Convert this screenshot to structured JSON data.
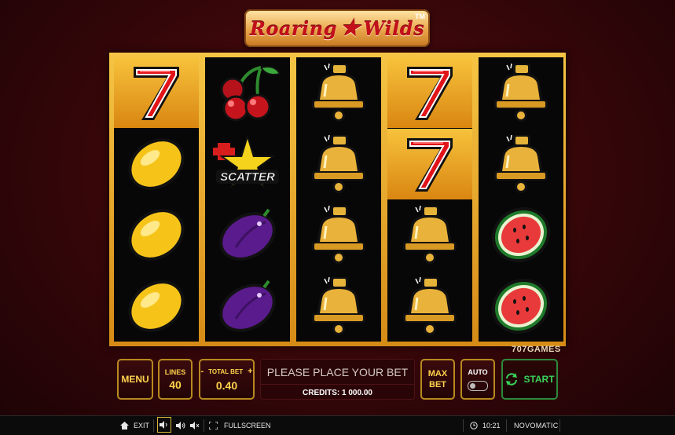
{
  "logo": {
    "text_left": "Roaring",
    "text_right": "Wilds",
    "tm": "TM"
  },
  "reels": [
    [
      "seven",
      "lemon",
      "lemon",
      "lemon"
    ],
    [
      "cherries",
      "scatter",
      "plum",
      "plum"
    ],
    [
      "bell",
      "bell",
      "bell",
      "bell"
    ],
    [
      "seven",
      "seven",
      "bell",
      "bell"
    ],
    [
      "bell",
      "bell",
      "watermelon",
      "watermelon"
    ]
  ],
  "winning_cells": [
    [
      0,
      0
    ],
    [
      3,
      0
    ],
    [
      3,
      1
    ]
  ],
  "scatter_label": "SCATTER",
  "studio": "707GAMES",
  "controls": {
    "menu_label": "MENU",
    "lines_label": "LINES",
    "lines_value": "40",
    "total_bet_label": "TOTAL BET",
    "total_bet_minus": "-",
    "total_bet_plus": "+",
    "total_bet_value": "0.40",
    "message": "PLEASE PLACE YOUR BET",
    "credits": "CREDITS: 1 000.00",
    "max_bet_line1": "MAX",
    "max_bet_line2": "BET",
    "auto_label": "AUTO",
    "start_label": "START"
  },
  "bottom_bar": {
    "exit_label": "EXIT",
    "fullscreen_label": "FULLSCREEN",
    "time": "10:21",
    "brand": "NOVOMATIC"
  },
  "colors": {
    "background": "#3a070a",
    "gold": "#e9a93a",
    "button_text": "#ffd34d",
    "start_green": "#39d45a"
  }
}
